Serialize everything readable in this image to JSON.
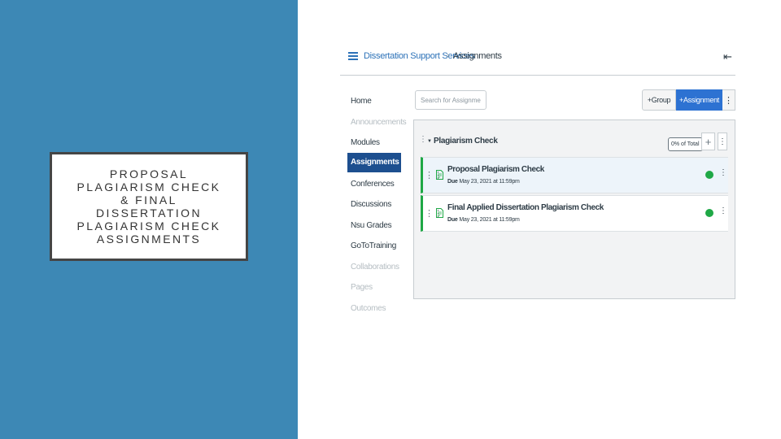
{
  "slide": {
    "title_lines": [
      "PROPOSAL",
      "PLAGIARISM CHECK",
      "& FINAL",
      "DISSERTATION",
      "PLAGIARISM CHECK",
      "ASSIGNMENTS"
    ]
  },
  "topbar": {
    "breadcrumb": [
      "Dissertation Support Services",
      "Assignments"
    ],
    "separator": "›"
  },
  "sidebar": {
    "items": [
      {
        "label": "Home",
        "state": "normal"
      },
      {
        "label": "Announcements",
        "state": "muted"
      },
      {
        "label": "Modules",
        "state": "normal"
      },
      {
        "label": "Assignments",
        "state": "active"
      },
      {
        "label": "Conferences",
        "state": "normal"
      },
      {
        "label": "Discussions",
        "state": "normal"
      },
      {
        "label": "Nsu Grades",
        "state": "normal"
      },
      {
        "label": "GoToTraining",
        "state": "normal"
      },
      {
        "label": "Collaborations",
        "state": "muted"
      },
      {
        "label": "Pages",
        "state": "muted"
      },
      {
        "label": "Outcomes",
        "state": "muted"
      }
    ]
  },
  "toolbar": {
    "search_placeholder": "Search for Assignment",
    "group_label": "Group",
    "assignment_label": "Assignment"
  },
  "group": {
    "title": "Plagiarism Check",
    "percent_badge": "0% of Total",
    "assignments": [
      {
        "title": "Proposal Plagiarism Check",
        "due_label": "Due",
        "due_date": "May 23, 2021 at 11:59pm"
      },
      {
        "title": "Final Applied Dissertation Plagiarism Check",
        "due_label": "Due",
        "due_date": "May 23, 2021 at 11:59pm"
      }
    ]
  },
  "colors": {
    "slide_blue": "#3d88b5",
    "nav_active": "#1d4f8f",
    "primary_button": "#2d72d2",
    "published_green": "#1fa846",
    "link_blue": "#2d72b8"
  },
  "icons": [
    "hamburger-icon",
    "collapse-icon",
    "drag-handle-icon",
    "caret-down-icon",
    "plus-icon",
    "kebab-icon",
    "assignment-doc-icon",
    "published-check-icon"
  ]
}
